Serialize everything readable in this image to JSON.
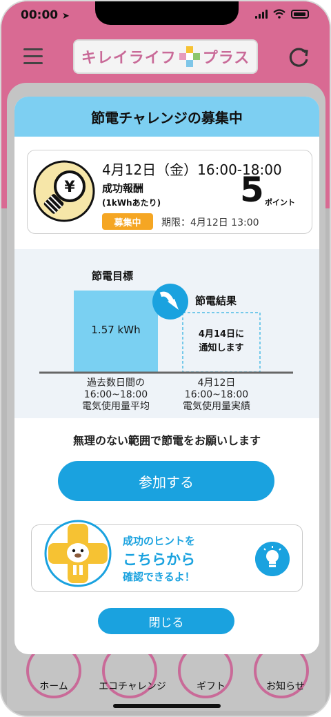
{
  "status_bar": {
    "time": "00:00"
  },
  "header": {
    "logo_left": "キレイライフ",
    "logo_right": "プラス"
  },
  "modal": {
    "title": "節電チャレンジの募集中",
    "card": {
      "date": "4月12日（金）16:00-18:00",
      "reward_label": "成功報酬",
      "reward_unit": "(1kWhあたり)",
      "points": "5",
      "points_unit": "ポイント",
      "status_badge": "募集中",
      "deadline": "期限：4月12日 13:00"
    },
    "chart": {
      "target_label": "節電目標",
      "result_label": "節電結果",
      "bar_value": "1.57 kWh",
      "result_note_line1": "4月14日に",
      "result_note_line2": "通知します",
      "left_caption": [
        "過去数日間の",
        "16:00~18:00",
        "電気使用量平均"
      ],
      "right_caption": [
        "4月12日",
        "16:00~18:00",
        "電気使用量実績"
      ]
    },
    "request_text": "無理のない範囲で節電をお願いします",
    "join_button": "参加する",
    "hint": {
      "line1": "成功のヒントを",
      "line2": "こちらから",
      "line3": "確認できるよ！"
    },
    "close_button": "閉じる"
  },
  "bottom_nav": {
    "items": [
      "ホーム",
      "エコチャレンジ",
      "ギフト",
      "お知らせ"
    ]
  },
  "colors": {
    "brand_pink": "#d96a93",
    "accent_blue": "#1aa2df",
    "header_blue": "#7dcff2",
    "badge_orange": "#f5a623",
    "bar_blue": "#7ad0f2"
  }
}
